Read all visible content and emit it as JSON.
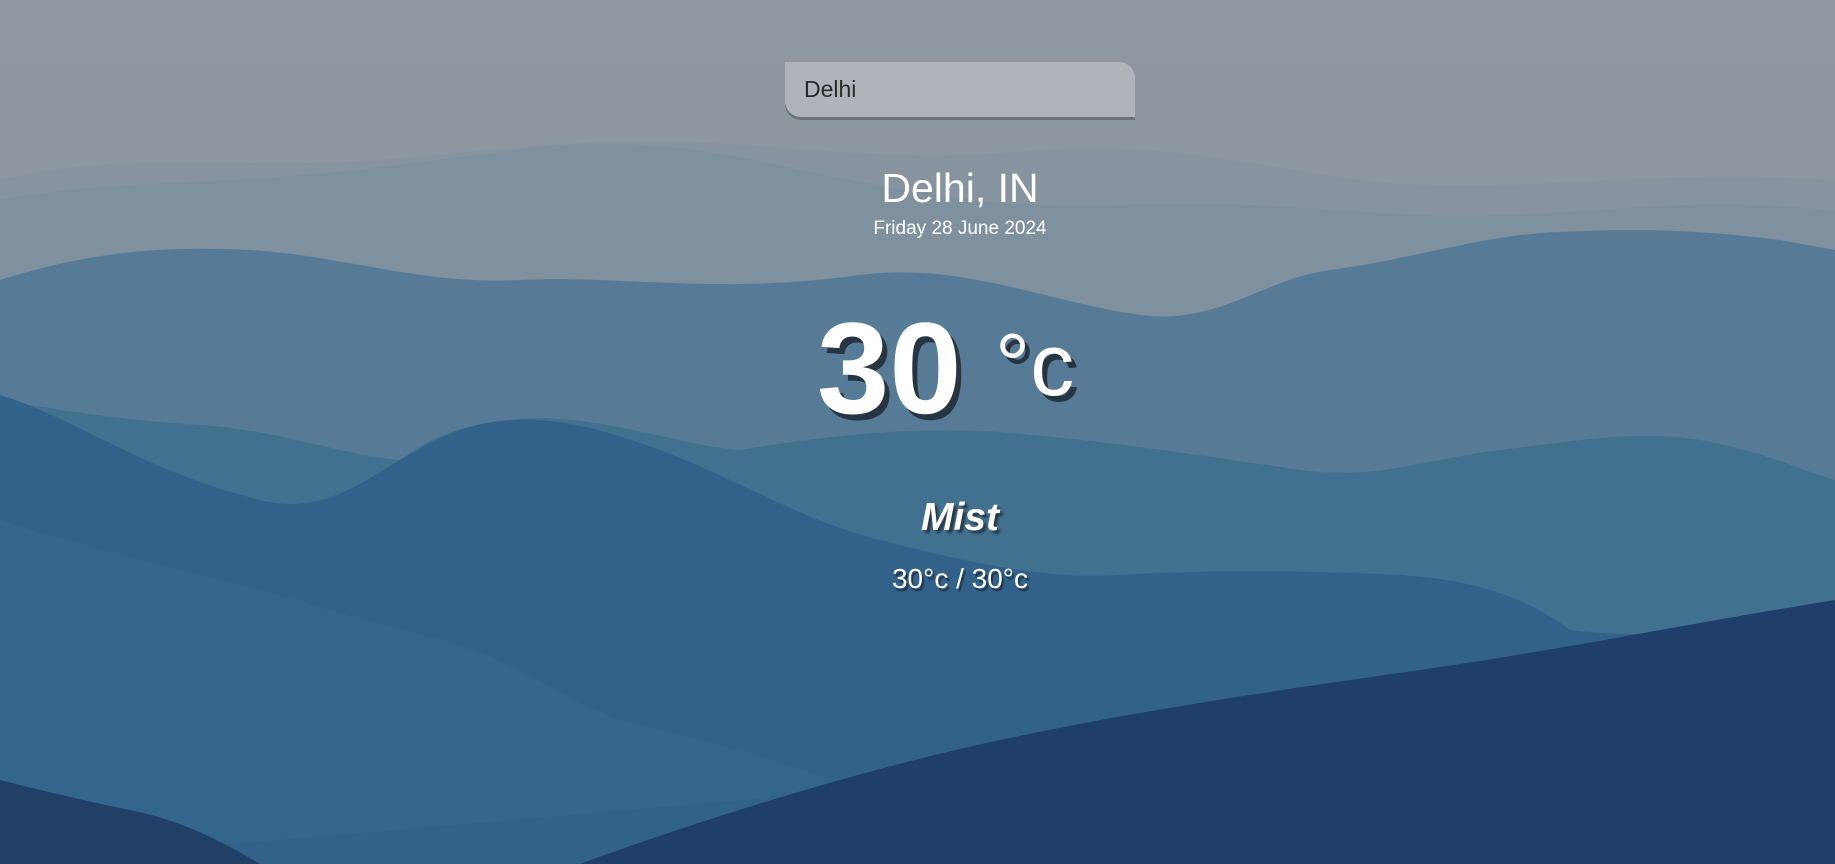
{
  "search": {
    "value": "Delhi",
    "placeholder": ""
  },
  "location": {
    "city": "Delhi, IN",
    "date": "Friday 28 June 2024"
  },
  "current": {
    "temp": "30",
    "unit": "°c",
    "weather": "Mist",
    "hi_low": "30°c / 30°c"
  },
  "colors": {
    "text": "#ffffff",
    "sky": "#8f98a1",
    "mountain_far": "#7f93a2",
    "mountain_mid": "#3d6d91",
    "mountain_near": "#1f3f6a"
  }
}
